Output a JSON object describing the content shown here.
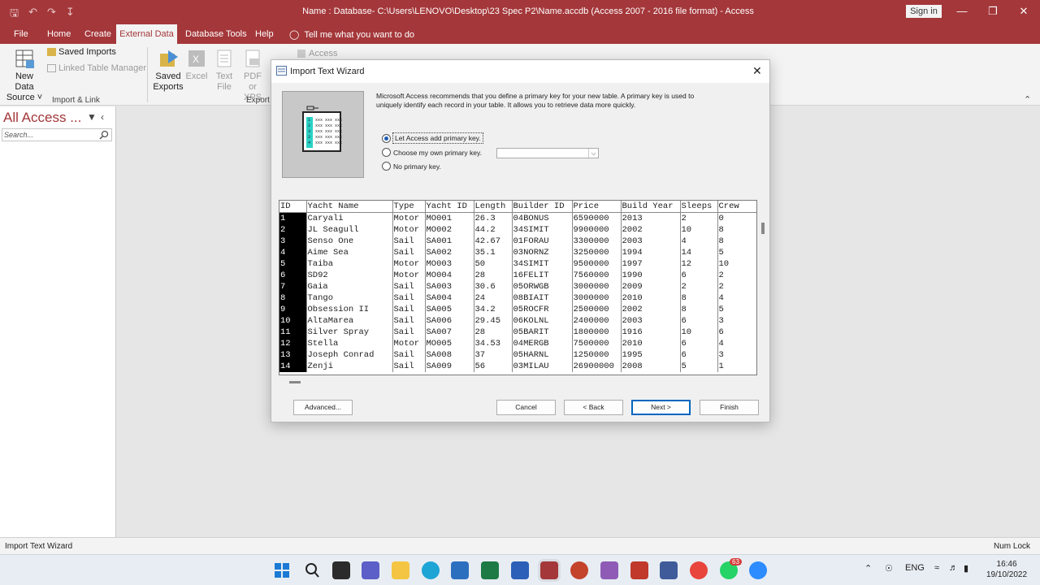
{
  "window": {
    "title": "Name : Database- C:\\Users\\LENOVO\\Desktop\\23 Spec P2\\Name.accdb (Access 2007 - 2016 file format)  -  Access",
    "sign_in": "Sign in"
  },
  "tabs": [
    {
      "label": "File"
    },
    {
      "label": "Home"
    },
    {
      "label": "Create"
    },
    {
      "label": "External Data",
      "active": true
    },
    {
      "label": "Database Tools"
    },
    {
      "label": "Help"
    }
  ],
  "tell_me": "Tell me what you want to do",
  "ribbon": {
    "new_data_source": "New Data Source",
    "new_data_source_l1": "New Data",
    "new_data_source_l2": "Source",
    "saved_imports": "Saved Imports",
    "linked_table_manager": "Linked Table Manager",
    "group_import": "Import & Link",
    "saved_exports_l1": "Saved",
    "saved_exports_l2": "Exports",
    "excel": "Excel",
    "text_file_l1": "Text",
    "text_file_l2": "File",
    "pdf_l1": "PDF",
    "pdf_l2": "or XPS",
    "access": "Access",
    "group_export": "Export"
  },
  "nav": {
    "title": "All Access ...",
    "search_placeholder": "Search..."
  },
  "status": {
    "left": "Import Text Wizard",
    "right": "Num Lock"
  },
  "dialog": {
    "title": "Import Text Wizard",
    "description": "Microsoft Access recommends that you define a primary key for your new table. A primary key is used to uniquely identify each record in your table. It allows you to retrieve data more quickly.",
    "options": [
      {
        "label": "Let Access add primary key.",
        "selected": true
      },
      {
        "label": "Choose my own primary key.",
        "selected": false
      },
      {
        "label": "No primary key.",
        "selected": false
      }
    ],
    "columns": [
      "ID",
      "Yacht Name",
      "Type",
      "Yacht ID",
      "Length",
      "Builder ID",
      "Price",
      "Build Year",
      "Sleeps",
      "Crew"
    ],
    "rows": [
      [
        "1",
        "Caryali",
        "Motor",
        "MO001",
        "26.3",
        "04BONUS",
        "6590000",
        "2013",
        "2",
        "0"
      ],
      [
        "2",
        "JL Seagull",
        "Motor",
        "MO002",
        "44.2",
        "34SIMIT",
        "9900000",
        "2002",
        "10",
        "8"
      ],
      [
        "3",
        "Senso One",
        "Sail",
        "SA001",
        "42.67",
        "01FORAU",
        "3300000",
        "2003",
        "4",
        "8"
      ],
      [
        "4",
        "Aime Sea",
        "Sail",
        "SA002",
        "35.1",
        "03NORNZ",
        "3250000",
        "1994",
        "14",
        "5"
      ],
      [
        "5",
        "Taiba",
        "Motor",
        "MO003",
        "50",
        "34SIMIT",
        "9500000",
        "1997",
        "12",
        "10"
      ],
      [
        "6",
        "SD92",
        "Motor",
        "MO004",
        "28",
        "16FELIT",
        "7560000",
        "1990",
        "6",
        "2"
      ],
      [
        "7",
        "Gaia",
        "Sail",
        "SA003",
        "30.6",
        "05ORWGB",
        "3000000",
        "2009",
        "2",
        "2"
      ],
      [
        "8",
        "Tango",
        "Sail",
        "SA004",
        "24",
        "08BIAIT",
        "3000000",
        "2010",
        "8",
        "4"
      ],
      [
        "9",
        "Obsession II",
        "Sail",
        "SA005",
        "34.2",
        "05ROCFR",
        "2500000",
        "2002",
        "8",
        "5"
      ],
      [
        "10",
        "AltaMarea",
        "Sail",
        "SA006",
        "29.45",
        "06KOLNL",
        "2400000",
        "2003",
        "6",
        "3"
      ],
      [
        "11",
        "Silver Spray",
        "Sail",
        "SA007",
        "28",
        "05BARIT",
        "1800000",
        "1916",
        "10",
        "6"
      ],
      [
        "12",
        "Stella",
        "Motor",
        "MO005",
        "34.53",
        "04MERGB",
        "7500000",
        "2010",
        "6",
        "4"
      ],
      [
        "13",
        "Joseph Conrad",
        "Sail",
        "SA008",
        "37",
        "05HARNL",
        "1250000",
        "1995",
        "6",
        "3"
      ],
      [
        "14",
        "Zenji",
        "Sail",
        "SA009",
        "56",
        "03MILAU",
        "26900000",
        "2008",
        "5",
        "1"
      ]
    ],
    "buttons": {
      "advanced": "Advanced...",
      "cancel": "Cancel",
      "back": "< Back",
      "next": "Next >",
      "finish": "Finish"
    }
  },
  "taskbar": {
    "language": "ENG",
    "time": "16:46",
    "date": "19/10/2022",
    "badge": "63"
  },
  "colors": {
    "access_red": "#a4373a",
    "ribbon_bg": "#f3f3f3",
    "accent_blue": "#0067c0"
  }
}
